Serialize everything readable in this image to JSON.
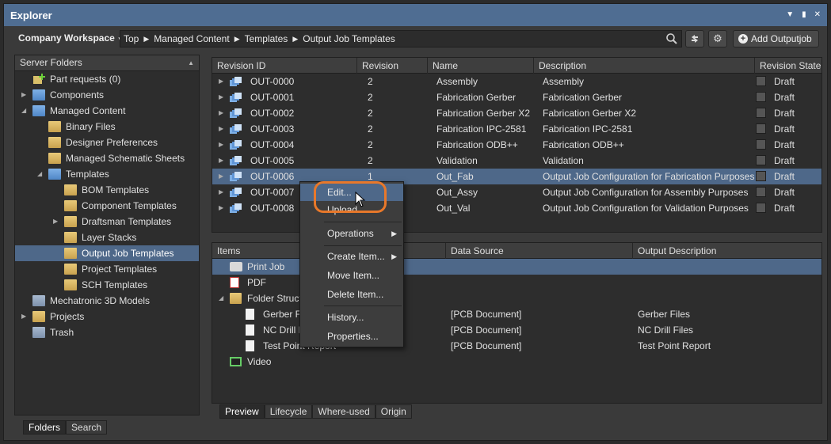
{
  "window": {
    "title": "Explorer"
  },
  "toolbar": {
    "workspace": "Company Workspace",
    "breadcrumbs": [
      "Top",
      "Managed Content",
      "Templates",
      "Output Job Templates"
    ],
    "add_button": "Add Outputjob"
  },
  "left_panel": {
    "header": "Server Folders",
    "items": [
      {
        "label": "Part requests (0)"
      },
      {
        "label": "Components"
      },
      {
        "label": "Managed Content"
      },
      {
        "label": "Binary Files"
      },
      {
        "label": "Designer Preferences"
      },
      {
        "label": "Managed Schematic Sheets"
      },
      {
        "label": "Templates"
      },
      {
        "label": "BOM Templates"
      },
      {
        "label": "Component Templates"
      },
      {
        "label": "Draftsman Templates"
      },
      {
        "label": "Layer Stacks"
      },
      {
        "label": "Output Job Templates"
      },
      {
        "label": "Project Templates"
      },
      {
        "label": "SCH Templates"
      },
      {
        "label": "Mechatronic 3D Models"
      },
      {
        "label": "Projects"
      },
      {
        "label": "Trash"
      }
    ],
    "tabs": [
      "Folders",
      "Search"
    ]
  },
  "grid": {
    "columns": [
      "Revision ID",
      "Revision",
      "Name",
      "Description",
      "Revision State"
    ],
    "rows": [
      {
        "id": "OUT-0000",
        "rev": "2",
        "name": "Assembly",
        "desc": "Assembly",
        "state": "Draft"
      },
      {
        "id": "OUT-0001",
        "rev": "2",
        "name": "Fabrication Gerber",
        "desc": "Fabrication Gerber",
        "state": "Draft"
      },
      {
        "id": "OUT-0002",
        "rev": "2",
        "name": "Fabrication Gerber X2",
        "desc": "Fabrication Gerber X2",
        "state": "Draft"
      },
      {
        "id": "OUT-0003",
        "rev": "2",
        "name": "Fabrication IPC-2581",
        "desc": "Fabrication IPC-2581",
        "state": "Draft"
      },
      {
        "id": "OUT-0004",
        "rev": "2",
        "name": "Fabrication ODB++",
        "desc": "Fabrication ODB++",
        "state": "Draft"
      },
      {
        "id": "OUT-0005",
        "rev": "2",
        "name": "Validation",
        "desc": "Validation",
        "state": "Draft"
      },
      {
        "id": "OUT-0006",
        "rev": "1",
        "name": "Out_Fab",
        "desc": "Output Job Configuration for Fabrication Purposes",
        "state": "Draft"
      },
      {
        "id": "OUT-0007",
        "rev": "",
        "name": "Out_Assy",
        "desc": "Output Job Configuration for Assembly Purposes",
        "state": "Draft"
      },
      {
        "id": "OUT-0008",
        "rev": "",
        "name": "Out_Val",
        "desc": "Output Job Configuration for Validation Purposes",
        "state": "Draft"
      }
    ]
  },
  "items_panel": {
    "columns": [
      "Items",
      "Data Source",
      "Output Description"
    ],
    "rows": [
      {
        "label": "Print Job",
        "source": "",
        "desc": ""
      },
      {
        "label": "PDF",
        "source": "",
        "desc": ""
      },
      {
        "label": "Folder Struct",
        "source": "",
        "desc": ""
      },
      {
        "label": "Gerber Fi",
        "source": "[PCB Document]",
        "desc": "Gerber Files"
      },
      {
        "label": "NC Drill F",
        "source": "[PCB Document]",
        "desc": "NC Drill Files"
      },
      {
        "label": "Test Point Report",
        "source": "[PCB Document]",
        "desc": "Test Point Report"
      },
      {
        "label": "Video",
        "source": "",
        "desc": ""
      }
    ],
    "tabs": [
      "Preview",
      "Lifecycle",
      "Where-used",
      "Origin"
    ]
  },
  "context_menu": {
    "items": [
      "Edit...",
      "Upload...",
      "Operations",
      "Create Item...",
      "Move Item...",
      "Delete Item...",
      "History...",
      "Properties..."
    ]
  },
  "colors": {
    "titlebar": "#4f6d92",
    "selection": "#4e6889",
    "highlight_ring": "#e8782a"
  }
}
